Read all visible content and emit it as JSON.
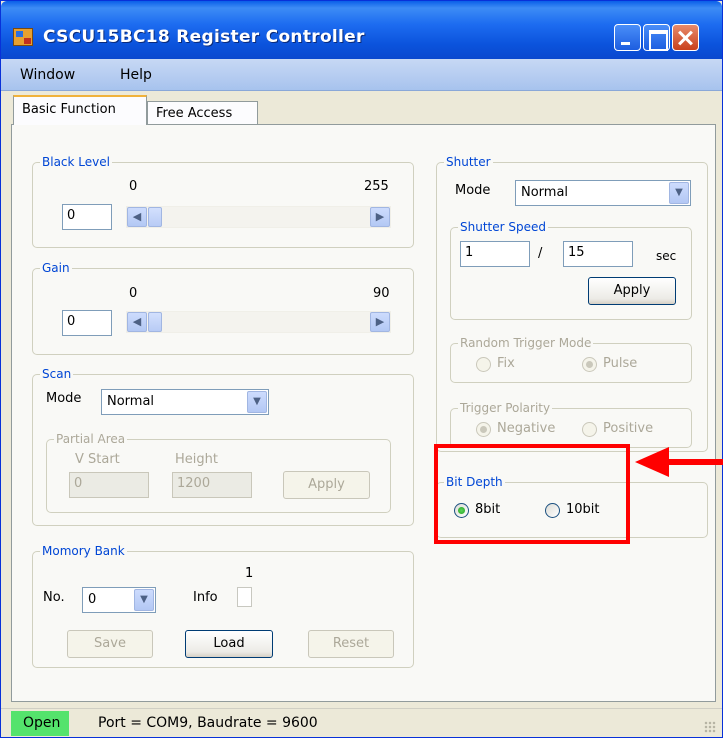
{
  "window": {
    "title": "CSCU15BC18 Register Controller"
  },
  "menu": {
    "items": [
      "Window",
      "Help"
    ]
  },
  "tabs": [
    "Basic Function",
    "Free Access"
  ],
  "black_level": {
    "title": "Black Level",
    "min_label": "0",
    "max_label": "255",
    "value": "0"
  },
  "gain": {
    "title": "Gain",
    "min_label": "0",
    "max_label": "90",
    "value": "0"
  },
  "scan": {
    "title": "Scan",
    "mode_label": "Mode",
    "mode_value": "Normal",
    "partial_area": {
      "title": "Partial Area",
      "vstart_label": "V Start",
      "height_label": "Height",
      "vstart_value": "0",
      "height_value": "1200",
      "apply_label": "Apply"
    }
  },
  "memory_bank": {
    "title": "Momory Bank",
    "no_label": "No.",
    "no_value": "0",
    "info_label": "Info",
    "info_value": "1",
    "save_label": "Save",
    "load_label": "Load",
    "reset_label": "Reset"
  },
  "shutter": {
    "title": "Shutter",
    "mode_label": "Mode",
    "mode_value": "Normal",
    "speed": {
      "title": "Shutter Speed",
      "numerator": "1",
      "separator": "/",
      "denominator": "15",
      "unit": "sec",
      "apply_label": "Apply"
    },
    "random_trigger": {
      "title": "Random Trigger Mode",
      "options": [
        "Fix",
        "Pulse"
      ],
      "selected": "Pulse"
    },
    "trigger_polarity": {
      "title": "Trigger Polarity",
      "options": [
        "Negative",
        "Positive"
      ],
      "selected": "Negative"
    }
  },
  "bit_depth": {
    "title": "Bit Depth",
    "options": [
      "8bit",
      "10bit"
    ],
    "selected": "8bit"
  },
  "status": {
    "state": "Open",
    "text": "Port = COM9,  Baudrate = 9600"
  },
  "colors": {
    "highlight": "#ff0000",
    "status_open": "#54e36c",
    "group_title": "#0046d5"
  },
  "icons": {
    "arrow_left": "◀",
    "arrow_right": "▶",
    "dropdown": "▼"
  }
}
